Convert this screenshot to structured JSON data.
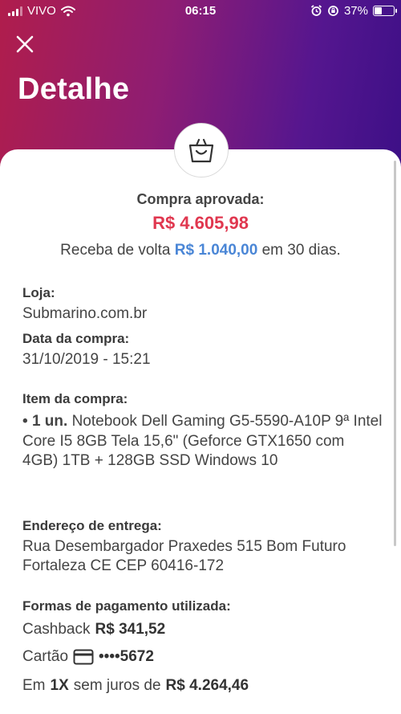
{
  "status_bar": {
    "carrier": "VIVO",
    "time": "06:15",
    "battery_text": "37%",
    "battery_level": 0.37
  },
  "header": {
    "title": "Detalhe"
  },
  "summary": {
    "status": "Compra aprovada:",
    "amount": "R$ 4.605,98",
    "cashback_prefix": "Receba de volta",
    "cashback_amount": "R$ 1.040,00",
    "cashback_suffix": "em 30 dias."
  },
  "store": {
    "label": "Loja:",
    "value": "Submarino.com.br"
  },
  "purchase_date": {
    "label": "Data da compra:",
    "value": "31/10/2019 - 15:21"
  },
  "item": {
    "label": "Item da compra:",
    "bullet": "•",
    "quantity": "1 un.",
    "description": "Notebook Dell Gaming G5-5590-A10P 9ª Intel Core I5 8GB Tela 15,6\" (Geforce GTX1650 com 4GB) 1TB + 128GB SSD Windows 10"
  },
  "address": {
    "label": "Endereço de entrega:",
    "value": "Rua Desembargador Praxedes  515  Bom Futuro  Fortaleza  CE CEP 60416-172"
  },
  "payment": {
    "label": "Formas de pagamento utilizada:",
    "cashback_label": "Cashback",
    "cashback_value": "R$ 341,52",
    "card_label": "Cartão",
    "card_number": "••••5672",
    "installment_prefix": "Em",
    "installment_count": "1X",
    "installment_middle": "sem juros de",
    "installment_value": "R$ 4.264,46"
  },
  "icons": {
    "close": "close-icon",
    "bag": "shopping-bag-icon",
    "card": "credit-card-icon"
  },
  "colors": {
    "amount": "#e0374f",
    "cashback_highlight": "#4a86d6",
    "header_gradient_start": "#b01d4c",
    "header_gradient_end": "#3c0f86"
  }
}
